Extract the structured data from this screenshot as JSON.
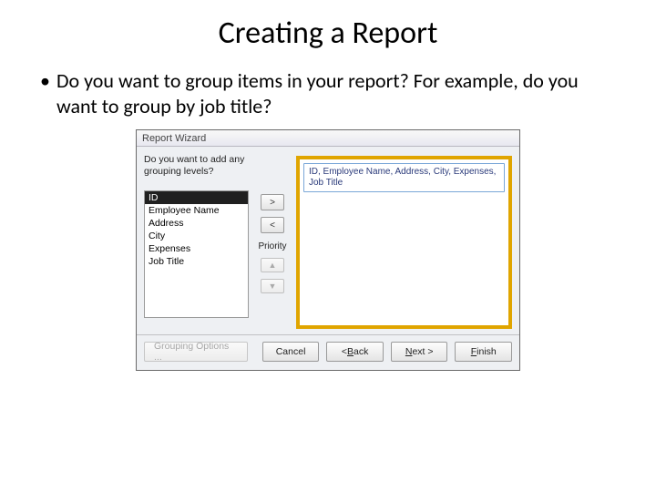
{
  "slide": {
    "title": "Creating a Report",
    "bullet": "Do you want to group items in your report?  For example, do you want to group by job title?"
  },
  "wizard": {
    "title": "Report Wizard",
    "question": "Do you want to add any grouping levels?",
    "fields": [
      "ID",
      "Employee Name",
      "Address",
      "City",
      "Expenses",
      "Job Title"
    ],
    "selected_index": 0,
    "priority_label": "Priority",
    "preview_summary": "ID, Employee Name, Address, City, Expenses, Job Title",
    "buttons": {
      "add": ">",
      "remove": "<",
      "up": "▲",
      "down": "▼",
      "grouping": "Grouping Options ...",
      "cancel": "Cancel",
      "back_full": "< Back",
      "next_full": "Next >",
      "finish_full": "Finish"
    }
  }
}
